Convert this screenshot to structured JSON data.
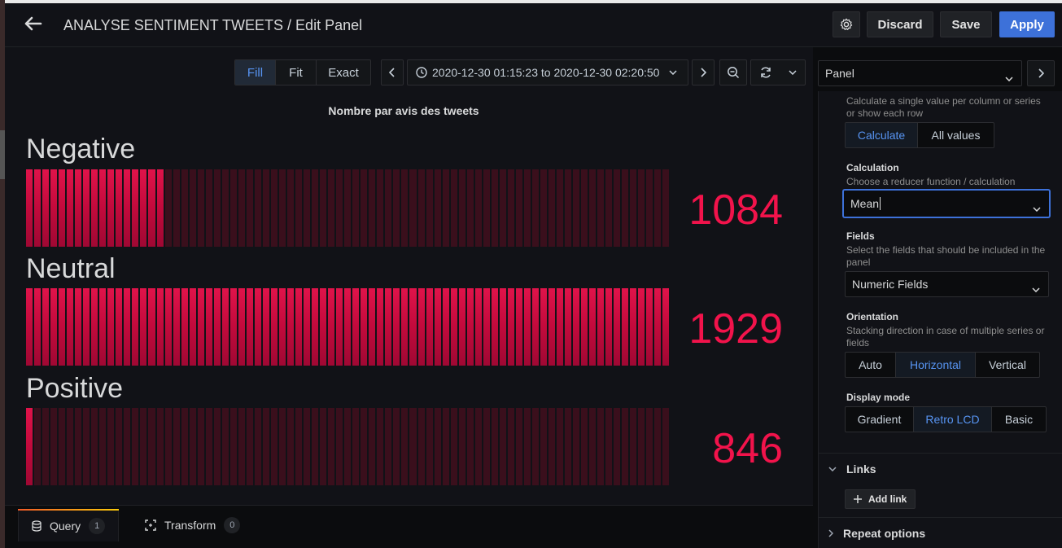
{
  "header": {
    "title": "ANALYSE SENTIMENT TWEETS / Edit Panel",
    "discard_label": "Discard",
    "save_label": "Save",
    "apply_label": "Apply"
  },
  "toolbar": {
    "view_modes": [
      "Fill",
      "Fit",
      "Exact"
    ],
    "active_view_mode": "Fill",
    "time_range": "2020-12-30 01:15:23 to 2020-12-30 02:20:50"
  },
  "panel": {
    "title": "Nombre par avis des tweets",
    "gauges": [
      {
        "label": "Negative",
        "value": "1084",
        "fill_fraction": 0.22
      },
      {
        "label": "Neutral",
        "value": "1929",
        "fill_fraction": 1.0
      },
      {
        "label": "Positive",
        "value": "846",
        "fill_fraction": 0.01
      }
    ],
    "value_color": "#f2134b",
    "bar_color_on": "#d40f44",
    "bar_color_off": "#3a0f1c"
  },
  "tabs": [
    {
      "label": "Query",
      "count": "1"
    },
    {
      "label": "Transform",
      "count": "0"
    }
  ],
  "options": {
    "panel_select": "Panel",
    "values_desc": "Calculate a single value per column or series or show each row",
    "values_options": [
      "Calculate",
      "All values"
    ],
    "values_active": "Calculate",
    "calculation": {
      "title": "Calculation",
      "desc": "Choose a reducer function / calculation",
      "value": "Mean"
    },
    "fields": {
      "title": "Fields",
      "desc": "Select the fields that should be included in the panel",
      "value": "Numeric Fields"
    },
    "orientation": {
      "title": "Orientation",
      "desc": "Stacking direction in case of multiple series or fields",
      "options": [
        "Auto",
        "Horizontal",
        "Vertical"
      ],
      "active": "Horizontal"
    },
    "display_mode": {
      "title": "Display mode",
      "options": [
        "Gradient",
        "Retro LCD",
        "Basic"
      ],
      "active": "Retro LCD"
    },
    "links_label": "Links",
    "add_link_label": "Add link",
    "repeat_label": "Repeat options"
  },
  "accent_color": "#5794f2",
  "primary_button_color": "#3d71d9"
}
